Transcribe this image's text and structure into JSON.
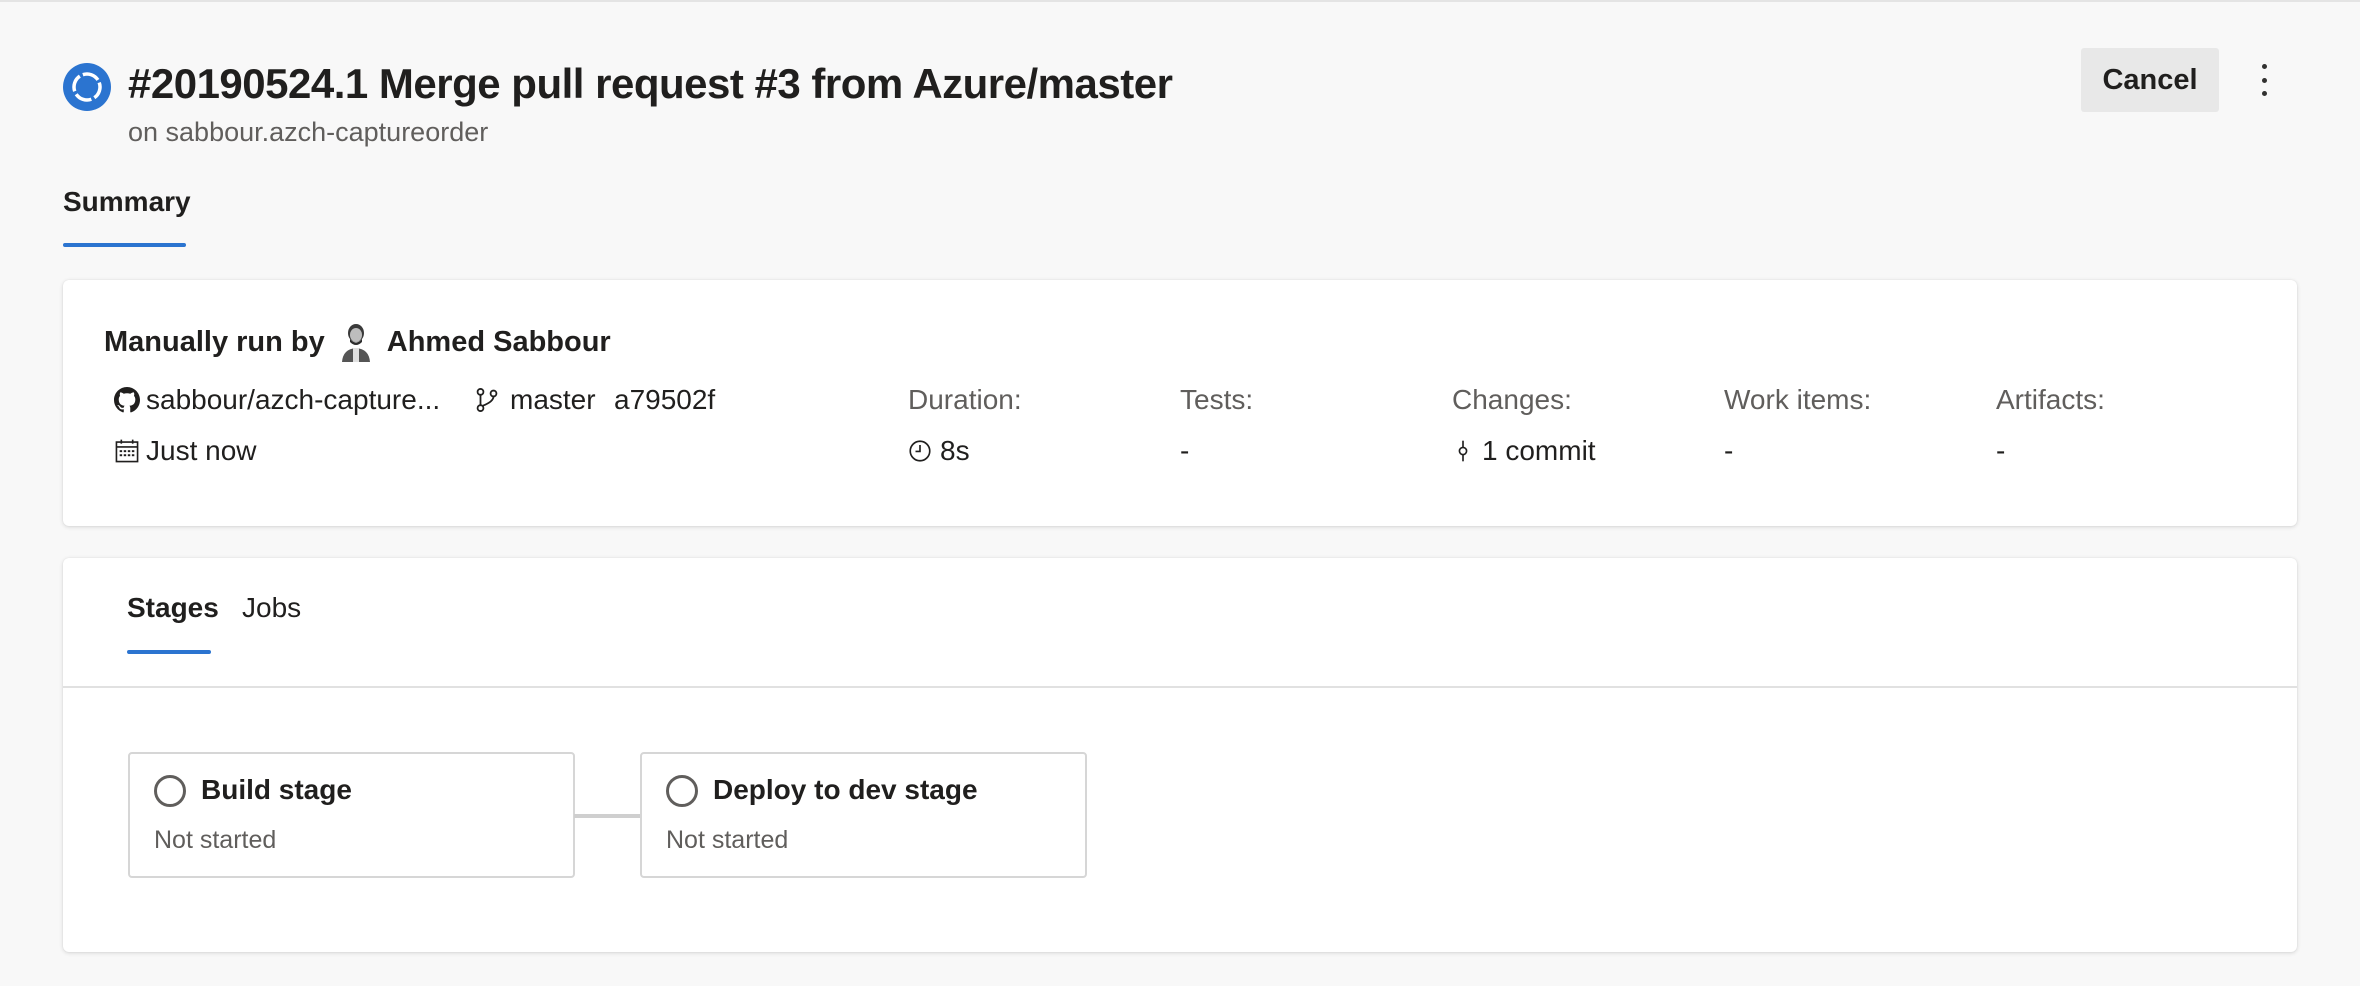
{
  "header": {
    "title": "#20190524.1 Merge pull request #3 from Azure/master",
    "subtitle": "on sabbour.azch-captureorder",
    "cancel_label": "Cancel",
    "status_icon": "in-progress-icon",
    "accent_color": "#2b74d0"
  },
  "tabs": {
    "summary_label": "Summary"
  },
  "run_info": {
    "run_by_prefix": "Manually run by",
    "user_name": "Ahmed Sabbour",
    "repository": "sabbour/azch-capture...",
    "branch": "master",
    "commit": "a79502f",
    "time": "Just now",
    "stats": [
      {
        "label": "Duration:",
        "value": "8s",
        "icon": "clock-icon"
      },
      {
        "label": "Tests:",
        "value": "-"
      },
      {
        "label": "Changes:",
        "value": "1 commit",
        "icon": "commit-icon"
      },
      {
        "label": "Work items:",
        "value": "-"
      },
      {
        "label": "Artifacts:",
        "value": "-"
      }
    ]
  },
  "stages_card": {
    "tabs": [
      "Stages",
      "Jobs"
    ],
    "stages": [
      {
        "name": "Build stage",
        "status": "Not started"
      },
      {
        "name": "Deploy to dev stage",
        "status": "Not started"
      }
    ]
  }
}
